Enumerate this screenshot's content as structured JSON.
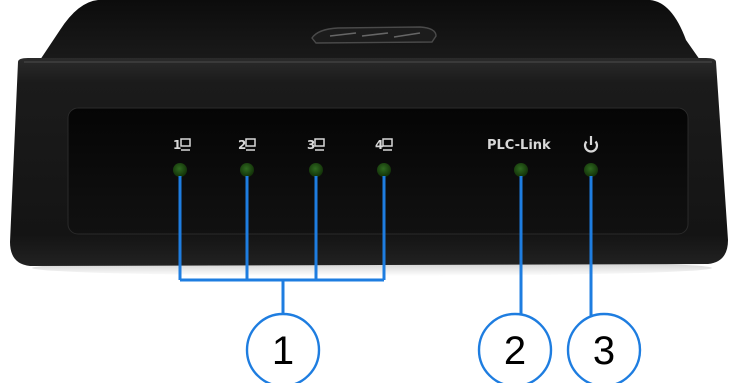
{
  "device": {
    "leds": [
      {
        "label": "1",
        "state": "off"
      },
      {
        "label": "2",
        "state": "off"
      },
      {
        "label": "3",
        "state": "off"
      },
      {
        "label": "4",
        "state": "off"
      },
      {
        "label": "PLC-Link",
        "state": "off"
      },
      {
        "label": "power",
        "state": "off"
      }
    ],
    "port_icon": "ethernet-port-icon",
    "power_icon": "power-icon",
    "colors": {
      "body": "#131313",
      "panel": "#0a0a0a",
      "led_off": "#1e4a14",
      "leader_line": "#1e7de0"
    }
  },
  "callouts": [
    {
      "number": "1"
    },
    {
      "number": "2"
    },
    {
      "number": "3"
    }
  ]
}
